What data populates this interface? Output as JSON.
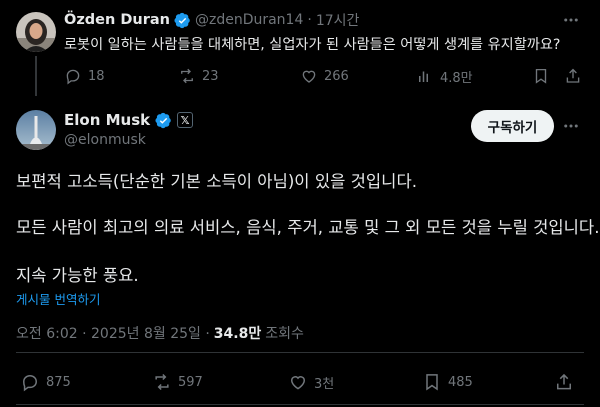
{
  "parent": {
    "author_name": "Özden Duran",
    "handle": "@zdenDuran14",
    "separator": "·",
    "time": "17시간",
    "text": "로봇이 일하는 사람들을 대체하면, 실업자가 된 사람들은 어떻게 생계를 유지할까요?",
    "replies": "18",
    "reposts": "23",
    "likes": "266",
    "views": "4.8만"
  },
  "main": {
    "author_name": "Elon Musk",
    "affiliate_badge": "𝕏",
    "handle": "@elonmusk",
    "subscribe_label": "구독하기",
    "lines": [
      "보편적 고소득(단순한 기본 소득이 아님)이 있을 것입니다.",
      "모든 사람이 최고의 의료 서비스, 음식, 주거, 교통 및 그 외 모든 것을 누릴 것입니다.",
      "지속 가능한 풍요."
    ],
    "translate_label": "게시물 번역하기",
    "timestamp": "오전 6:02 · 2025년 8월 25일 ·",
    "views_count": "34.8만",
    "views_label": "조회수",
    "replies": "875",
    "reposts": "597",
    "likes": "3천",
    "bookmarks": "485"
  },
  "colors": {
    "background": "#000000",
    "text": "#e7e9ea",
    "muted": "#71767b",
    "link": "#1d9bf0",
    "verified": "#1d9bf0"
  }
}
